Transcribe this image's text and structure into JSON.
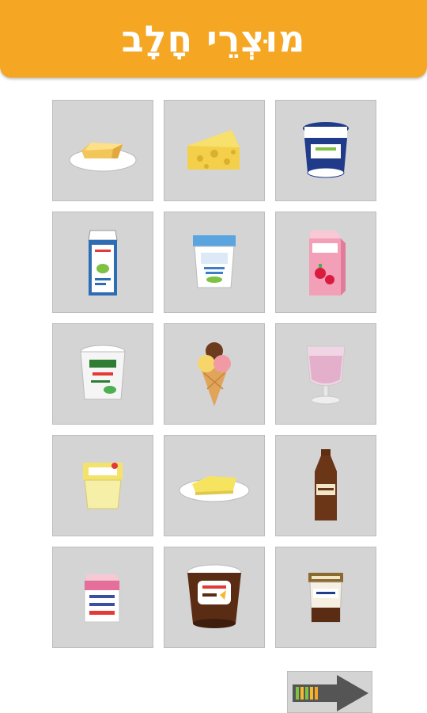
{
  "header": {
    "title": "מוּצְרֵי חָלָב"
  },
  "grid": {
    "items": [
      {
        "icon": "butter-icon"
      },
      {
        "icon": "cheese-wedge-icon"
      },
      {
        "icon": "yogurt-tub-icon"
      },
      {
        "icon": "milk-carton-icon"
      },
      {
        "icon": "yogurt-cup-icon"
      },
      {
        "icon": "strawberry-milk-carton-icon"
      },
      {
        "icon": "cottage-cheese-icon"
      },
      {
        "icon": "ice-cream-cone-icon"
      },
      {
        "icon": "milkshake-glass-icon"
      },
      {
        "icon": "yellow-cheese-cup-icon"
      },
      {
        "icon": "cheese-slice-plate-icon"
      },
      {
        "icon": "chocolate-milk-bottle-icon"
      },
      {
        "icon": "cream-carton-icon"
      },
      {
        "icon": "chocolate-pudding-icon"
      },
      {
        "icon": "layered-dessert-cup-icon"
      }
    ]
  },
  "next_button": {
    "icon": "arrow-right-icon"
  },
  "colors": {
    "header": "#f5a623",
    "tile": "#d4d4d4"
  }
}
